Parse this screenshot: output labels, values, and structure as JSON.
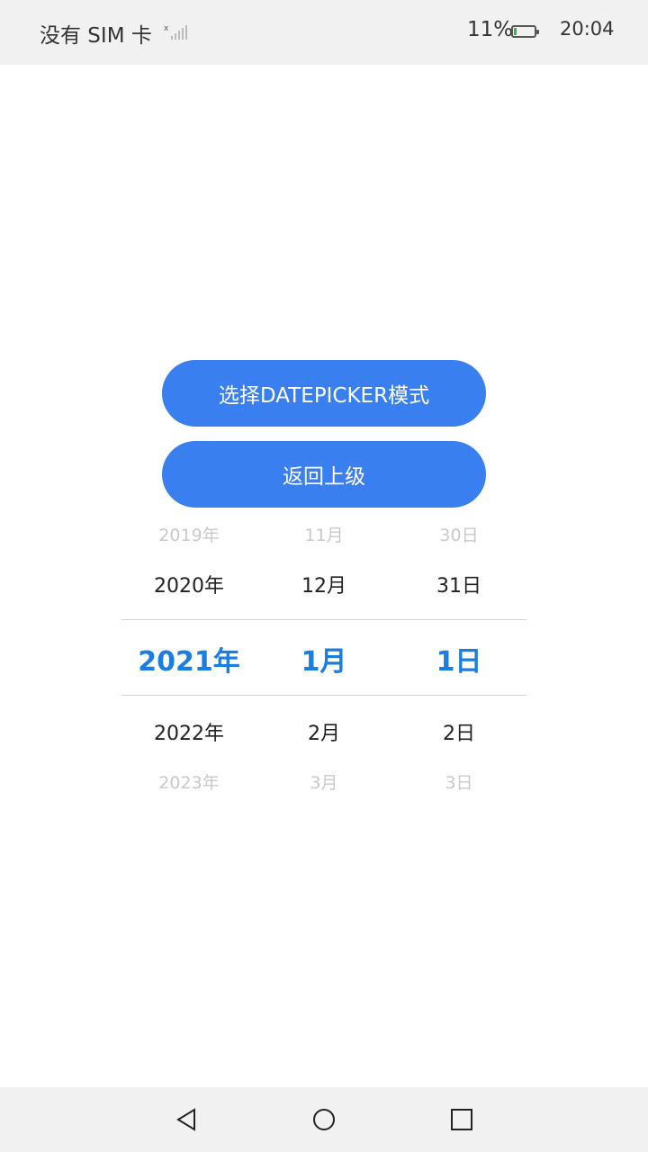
{
  "status_bar": {
    "carrier": "没有 SIM 卡",
    "battery_percent": "11%",
    "battery_level": 0.11,
    "time": "20:04",
    "icons": [
      "signal-icon",
      "battery-icon"
    ]
  },
  "buttons": {
    "mode_label": "选择DATEPICKER模式",
    "back_label": "返回上级"
  },
  "date_picker": {
    "years": [
      "2019年",
      "2020年",
      "2021年",
      "2022年",
      "2023年"
    ],
    "months": [
      "11月",
      "12月",
      "1月",
      "2月",
      "3月"
    ],
    "days": [
      "30日",
      "31日",
      "1日",
      "2日",
      "3日"
    ],
    "selected": {
      "year": "2021年",
      "month": "1月",
      "day": "1日"
    }
  },
  "nav_bar": {
    "icons": [
      "back-triangle-icon",
      "home-circle-icon",
      "recents-square-icon"
    ]
  },
  "colors": {
    "accent": "#3a7ff0",
    "selected_text": "#1a7de0",
    "status_bar_bg": "#f1f1f2"
  }
}
